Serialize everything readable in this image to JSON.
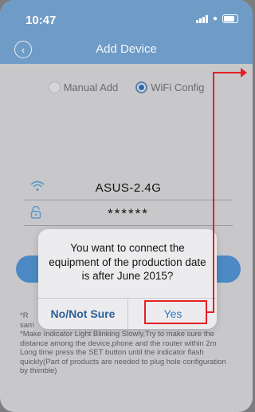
{
  "status_bar": {
    "time": "10:47"
  },
  "header": {
    "title": "Add Device"
  },
  "mode": {
    "manual_label": "Manual Add",
    "wifi_label": "WiFi Config",
    "selected": "WiFi Config"
  },
  "wifi": {
    "ssid": "ASUS-2.4G",
    "password_masked": "******"
  },
  "tips": {
    "line1": "*R",
    "line2": "sam",
    "line3": "*Make Indicator Light Blinking Slowly,Try to make sure the distance among the device,phone and the router within 2m",
    "line4": "Long time press the SET button until the indicator flash quickly(Part of products are needed to plug hole configuration by thimble)"
  },
  "dialog": {
    "message": "You want to connect the equipment of the production date is after June 2015?",
    "no_label": "No/Not Sure",
    "yes_label": "Yes"
  },
  "colors": {
    "header": "#6f9bc7",
    "accent": "#2f78c4",
    "annotation": "#e32025"
  }
}
